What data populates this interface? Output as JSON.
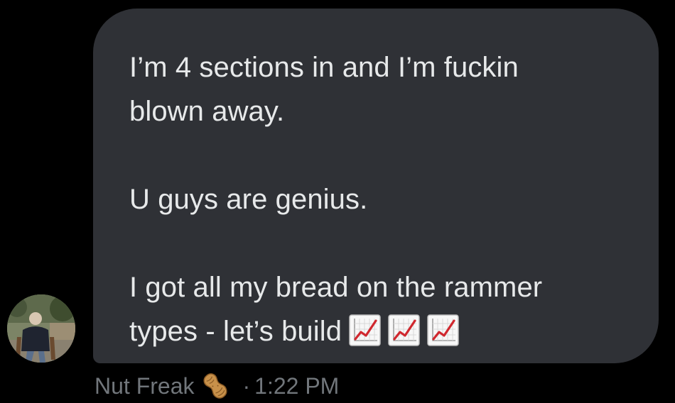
{
  "message": {
    "lines": [
      "I’m 4 sections in and I’m fuckin",
      "blown away.",
      "",
      "U guys are genius.",
      "",
      "I got all my bread on the rammer",
      "types - let’s build"
    ],
    "trailing_emojis": [
      "chart-increasing-icon",
      "chart-increasing-icon",
      "chart-increasing-icon"
    ]
  },
  "sender": {
    "name": "Nut Freak",
    "name_emoji": "peanut-icon",
    "avatar": "avatar"
  },
  "timestamp": {
    "separator": "·",
    "time": "1:22 PM"
  },
  "colors": {
    "background": "#000000",
    "bubble": "#2f3136",
    "message_text": "#e7e9ea",
    "meta_text": "#71767b",
    "chart_line": "#d0272e"
  }
}
